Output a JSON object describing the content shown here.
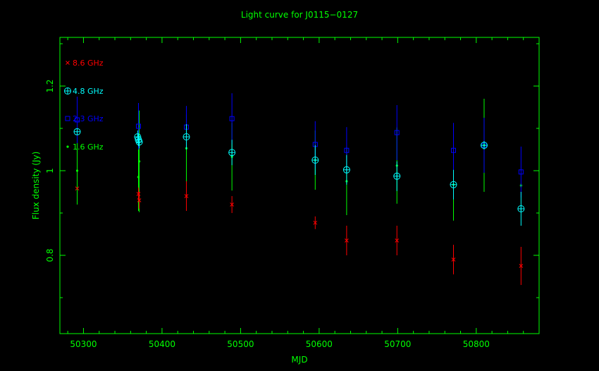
{
  "chart_data": {
    "type": "scatter",
    "title": "Light curve for J0115−0127",
    "xlabel": "MJD",
    "ylabel": "Flux density (Jy)",
    "xlim": [
      50270,
      50880
    ],
    "ylim": [
      0.615,
      1.315
    ],
    "xticks": [
      50300,
      50400,
      50500,
      50600,
      50700,
      50800
    ],
    "yticks": [
      0.8,
      1,
      1.2
    ],
    "ytick_labels": [
      "0.8",
      "1",
      "1.2"
    ],
    "legend_position": "top-left",
    "series": [
      {
        "name": "8.6 GHz",
        "color": "#ff0000",
        "marker": "x",
        "points": [
          {
            "x": 50292,
            "y": 0.958,
            "err": 0
          },
          {
            "x": 50370,
            "y": 0.945,
            "err": 0.015
          },
          {
            "x": 50371,
            "y": 0.93,
            "err": 0.02
          },
          {
            "x": 50431,
            "y": 0.94,
            "err": 0.035
          },
          {
            "x": 50489,
            "y": 0.92,
            "err": 0.02
          },
          {
            "x": 50595,
            "y": 0.877,
            "err": 0.015
          },
          {
            "x": 50635,
            "y": 0.835,
            "err": 0.035
          },
          {
            "x": 50699,
            "y": 0.835,
            "err": 0.035
          },
          {
            "x": 50771,
            "y": 0.79,
            "err": 0.035
          },
          {
            "x": 50857,
            "y": 0.775,
            "err": 0.045
          }
        ]
      },
      {
        "name": "4.8 GHz",
        "color": "#00ffff",
        "marker": "circle-plus",
        "points": [
          {
            "x": 50292,
            "y": 1.092,
            "err": 0
          },
          {
            "x": 50369,
            "y": 1.08,
            "err": 0.015
          },
          {
            "x": 50370,
            "y": 1.073,
            "err": 0.015
          },
          {
            "x": 50371,
            "y": 1.068,
            "err": 0.015
          },
          {
            "x": 50431,
            "y": 1.08,
            "err": 0.03
          },
          {
            "x": 50489,
            "y": 1.043,
            "err": 0.03
          },
          {
            "x": 50595,
            "y": 1.025,
            "err": 0.035
          },
          {
            "x": 50635,
            "y": 1.002,
            "err": 0.035
          },
          {
            "x": 50699,
            "y": 0.987,
            "err": 0.035
          },
          {
            "x": 50771,
            "y": 0.967,
            "err": 0.035
          },
          {
            "x": 50810,
            "y": 1.06,
            "err": 0.01
          },
          {
            "x": 50857,
            "y": 0.91,
            "err": 0.04
          }
        ]
      },
      {
        "name": "2.3 GHz",
        "color": "#0000ff",
        "marker": "square",
        "points": [
          {
            "x": 50292,
            "y": 1.12,
            "err": 0.055
          },
          {
            "x": 50370,
            "y": 1.105,
            "err": 0.055
          },
          {
            "x": 50431,
            "y": 1.103,
            "err": 0.05
          },
          {
            "x": 50489,
            "y": 1.123,
            "err": 0.06
          },
          {
            "x": 50595,
            "y": 1.062,
            "err": 0.055
          },
          {
            "x": 50635,
            "y": 1.048,
            "err": 0.055
          },
          {
            "x": 50699,
            "y": 1.09,
            "err": 0.065
          },
          {
            "x": 50771,
            "y": 1.048,
            "err": 0.065
          },
          {
            "x": 50810,
            "y": 1.06,
            "err": 0.065
          },
          {
            "x": 50857,
            "y": 0.997,
            "err": 0.06
          }
        ]
      },
      {
        "name": "1.6 GHz",
        "color": "#00ff00",
        "marker": "dot",
        "points": [
          {
            "x": 50292,
            "y": 1.0,
            "err": 0.08
          },
          {
            "x": 50370,
            "y": 0.985,
            "err": 0.08
          },
          {
            "x": 50371,
            "y": 1.022,
            "err": 0.12
          },
          {
            "x": 50431,
            "y": 1.053,
            "err": 0.08
          },
          {
            "x": 50489,
            "y": 1.033,
            "err": 0.08
          },
          {
            "x": 50595,
            "y": 1.025,
            "err": 0.07
          },
          {
            "x": 50635,
            "y": 0.975,
            "err": 0.08
          },
          {
            "x": 50699,
            "y": 1.012,
            "err": 0.09
          },
          {
            "x": 50771,
            "y": 0.967,
            "err": 0.085
          },
          {
            "x": 50810,
            "y": 1.06,
            "err": 0.11
          },
          {
            "x": 50857,
            "y": 0.965,
            "err": 0.005
          }
        ]
      }
    ]
  }
}
